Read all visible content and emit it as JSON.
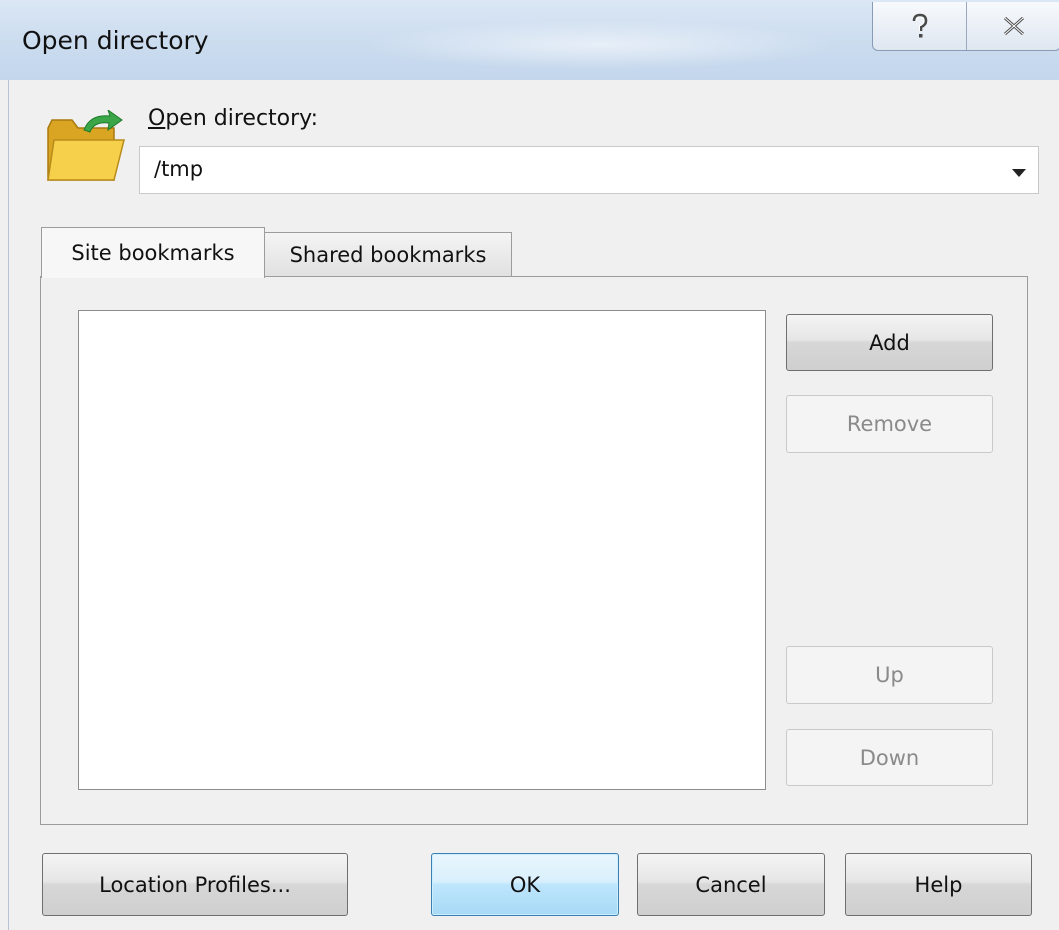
{
  "window": {
    "title": "Open directory",
    "help_glyph": "?",
    "close_glyph": "X"
  },
  "open_directory": {
    "label": "Open directory:",
    "mnemonic": "O",
    "label_rest": "pen directory:",
    "value": "/tmp"
  },
  "tabs": [
    {
      "label": "Site bookmarks",
      "active": true
    },
    {
      "label": "Shared bookmarks",
      "active": false
    }
  ],
  "bookmark_buttons": {
    "add": "Add",
    "remove": "Remove",
    "up": "Up",
    "down": "Down"
  },
  "footer_buttons": {
    "location_profiles": "Location Profiles...",
    "ok": "OK",
    "cancel": "Cancel",
    "help": "Help"
  },
  "icons": {
    "folder": "folder-open-icon",
    "help": "help-icon",
    "close": "close-icon",
    "dropdown": "chevron-down-icon"
  }
}
